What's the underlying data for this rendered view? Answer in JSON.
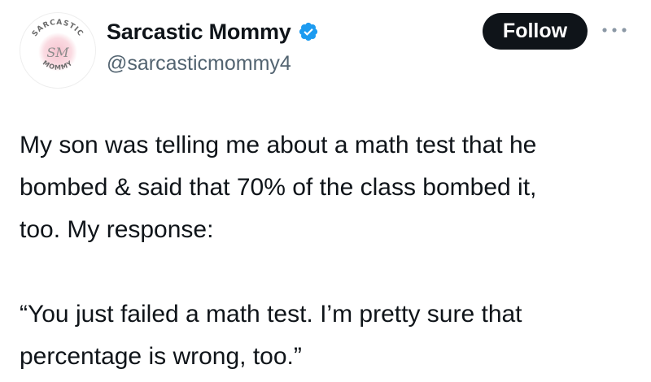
{
  "tweet": {
    "author": {
      "display_name": "Sarcastic Mommy",
      "handle": "@sarcasticmommy4",
      "verified": true,
      "avatar_icon": "sarcastic-mommy-logo",
      "avatar_text": {
        "top": "SARCASTIC",
        "bottom": "MOMMY",
        "monogram": "SM"
      }
    },
    "follow_label": "Follow",
    "more_icon": "ellipsis-icon",
    "body": {
      "paragraph_1": "My son was telling me about a math test that he\nbombed & said that 70% of the class bombed it,\ntoo.  My response:",
      "paragraph_2": "“You just failed a math test. I’m pretty sure that\npercentage is wrong, too.”"
    }
  },
  "colors": {
    "text": "#0f1419",
    "secondary_text": "#536471",
    "verified_badge": "#1d9bf0",
    "follow_button_bg": "#0f1419",
    "avatar_accent": "#f4b6c2"
  }
}
